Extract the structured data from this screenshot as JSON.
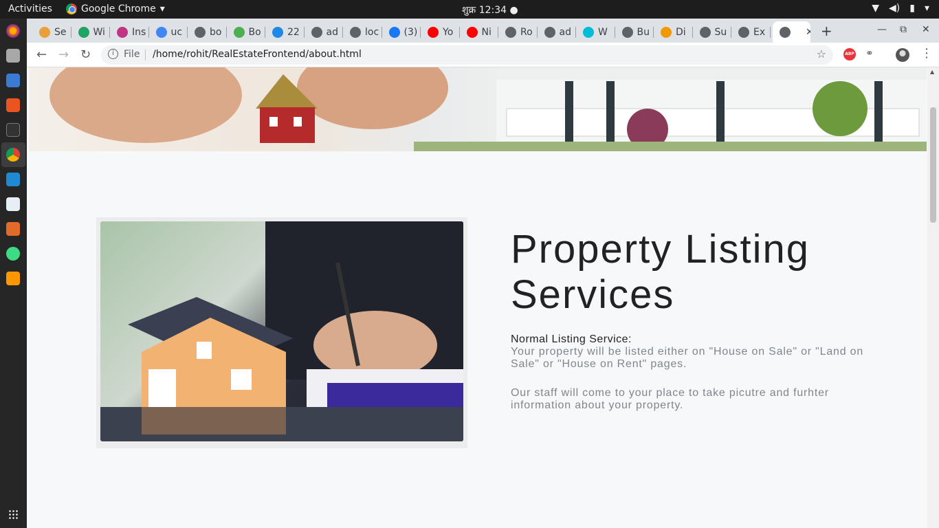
{
  "system": {
    "activities": "Activities",
    "app_name": "Google Chrome",
    "clock": "शुक्र 12:34",
    "dock_icons": [
      "firefox-icon",
      "files-icon",
      "docs-icon",
      "software-center-icon",
      "terminal-icon",
      "chrome-icon",
      "vscode-icon",
      "text-editor-icon",
      "document-viewer-icon",
      "android-studio-icon",
      "sublime-icon"
    ]
  },
  "browser": {
    "tabs": [
      {
        "label": "Se",
        "color": "#e8a13a"
      },
      {
        "label": "Wi",
        "color": "#1fa463"
      },
      {
        "label": "Ins",
        "color": "#c13584"
      },
      {
        "label": "uc",
        "color": "#4285f4"
      },
      {
        "label": "bo",
        "color": "#5f6368"
      },
      {
        "label": "Bo",
        "color": "#4caf50"
      },
      {
        "label": "22",
        "color": "#1e88e5"
      },
      {
        "label": "ad",
        "color": "#5f6368"
      },
      {
        "label": "loc",
        "color": "#5f6368"
      },
      {
        "label": "(3)",
        "color": "#1877f2"
      },
      {
        "label": "Yo",
        "color": "#ff0000"
      },
      {
        "label": "Ni",
        "color": "#ff0000"
      },
      {
        "label": "Ro",
        "color": "#5f6368"
      },
      {
        "label": "ad",
        "color": "#5f6368"
      },
      {
        "label": "W",
        "color": "#00bcd4"
      },
      {
        "label": "Bu",
        "color": "#5f6368"
      },
      {
        "label": "Di",
        "color": "#f29900"
      },
      {
        "label": "Su",
        "color": "#5f6368"
      },
      {
        "label": "Ex",
        "color": "#5f6368"
      }
    ],
    "address_scheme": "File",
    "url": "/home/rohit/RealEstateFrontend/about.html",
    "abp_label": "ABP"
  },
  "page": {
    "heading": "Property Listing Services",
    "subheading": "Normal Listing Service:",
    "paragraph1": "Your property will be listed either on \"House on Sale\" or \"Land on Sale\" or \"House on Rent\" pages.",
    "paragraph2": "Our staff will come to your place to take picutre and furhter information about your property."
  }
}
